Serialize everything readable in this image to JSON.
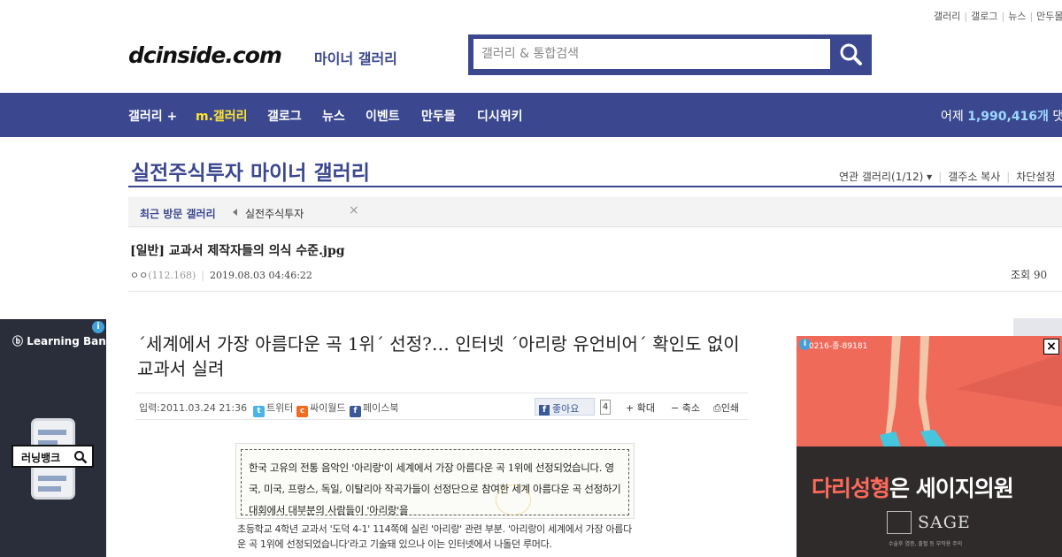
{
  "top_links": [
    "갤러리",
    "갤로그",
    "뉴스",
    "만두몰"
  ],
  "logo": {
    "text": "dcinside.com",
    "sub": "마이너 갤러리"
  },
  "search": {
    "placeholder": "갤러리 & 통합검색"
  },
  "nav": {
    "items": [
      "갤러리 +",
      "m.갤러리",
      "갤로그",
      "뉴스",
      "이벤트",
      "만두몰",
      "디시위키"
    ],
    "active_index": 1,
    "stats_prefix": "어제",
    "stats_value": "1,990,416개",
    "stats_suffix": "댓글"
  },
  "gallery": {
    "title": "실전주식투자 마이너 갤러리",
    "tools": [
      "연관 갤러리(1/12)",
      "갤주소 복사",
      "차단설정"
    ]
  },
  "recent": {
    "title": "최근 방문 갤러리",
    "item": "실전주식투자",
    "close": "×"
  },
  "post": {
    "title": "[일반] 교과서 제작자들의 의식 수준.jpg",
    "nick": "ㅇㅇ",
    "ip": "(112.168)",
    "date": "2019.08.03 04:46:22",
    "views": "조회 90"
  },
  "left_ad": {
    "brand": "Learning Bank",
    "search_word": "러닝뱅크",
    "info": "i"
  },
  "article": {
    "headline": "´세계에서 가장 아름다운 곡 1위´ 선정?… 인터넷 ´아리랑 유언비어´ 확인도 없이 교과서 실려",
    "date": "입력:2011.03.24 21:36",
    "share": [
      "트위터",
      "싸이월드",
      "페이스북"
    ],
    "like_label": "좋아요",
    "like_count": "4",
    "tools": [
      "+ 확대",
      "− 축소",
      "인쇄"
    ],
    "scan_text": "한국 고유의 전통 음악인 '아리랑'이 세계에서 가장 아름다운 곡 1위에 선정되었습니다. 영국, 미국, 프랑스, 독일, 이탈리아 작곡가들이 선정단으로 참여한 세계 아름다운 곡 선정하기 대회에서 대부분의 사람들이 '아리랑'을",
    "body": "초등학교 4학년 교과서 '도덕 4-1' 114쪽에 실린 '아리랑' 관련 부분. '아리랑이 세계에서 가장 아름다운 곡 1위에 선정되었습니다'라고 기술돼 있으나 이는 인터넷에서 나돌던 루머다."
  },
  "right_ad": {
    "code": "0216-종-89181",
    "headline_hl": "다리성형",
    "headline_rest": "은 세이지의원",
    "brand": "SAGE",
    "fine": "수술후 염증, 출혈 등 부작용 주의"
  },
  "colors": {
    "brand": "#3b4890",
    "active_nav": "#ffe42d",
    "ad_coral": "#f06a5a"
  }
}
